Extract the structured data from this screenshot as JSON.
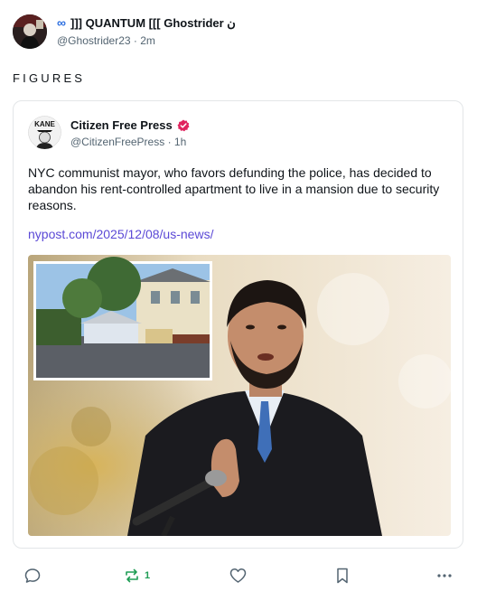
{
  "post": {
    "author_icon": "infinity-icon",
    "author_name": "]]] QUANTUM [[[ Ghostrider ن",
    "author_handle": "@Ghostrider23",
    "separator": "·",
    "time": "2m",
    "text": "FIGURES"
  },
  "quote": {
    "avatar_text": "KANE",
    "author_name": "Citizen Free Press",
    "verified_icon": "verified-badge-icon",
    "author_handle": "@CitizenFreePress",
    "separator": "·",
    "time": "1h",
    "text": "NYC communist mayor, who favors defunding the police, has decided to abandon his rent-controlled apartment to live in a mansion due to security reasons.",
    "link": "nypost.com/2025/12/08/us-news/",
    "image_icon": "news-photo-mayor-mansion"
  },
  "actions": {
    "reply_icon": "reply-icon",
    "repost_icon": "repost-icon",
    "repost_count": "1",
    "like_icon": "heart-icon",
    "bookmark_icon": "bookmark-icon",
    "more_icon": "more-icon"
  },
  "colors": {
    "link": "#5b49d6",
    "repost_active": "#1f9d55",
    "verified": "#e0245e",
    "muted": "#536471"
  }
}
